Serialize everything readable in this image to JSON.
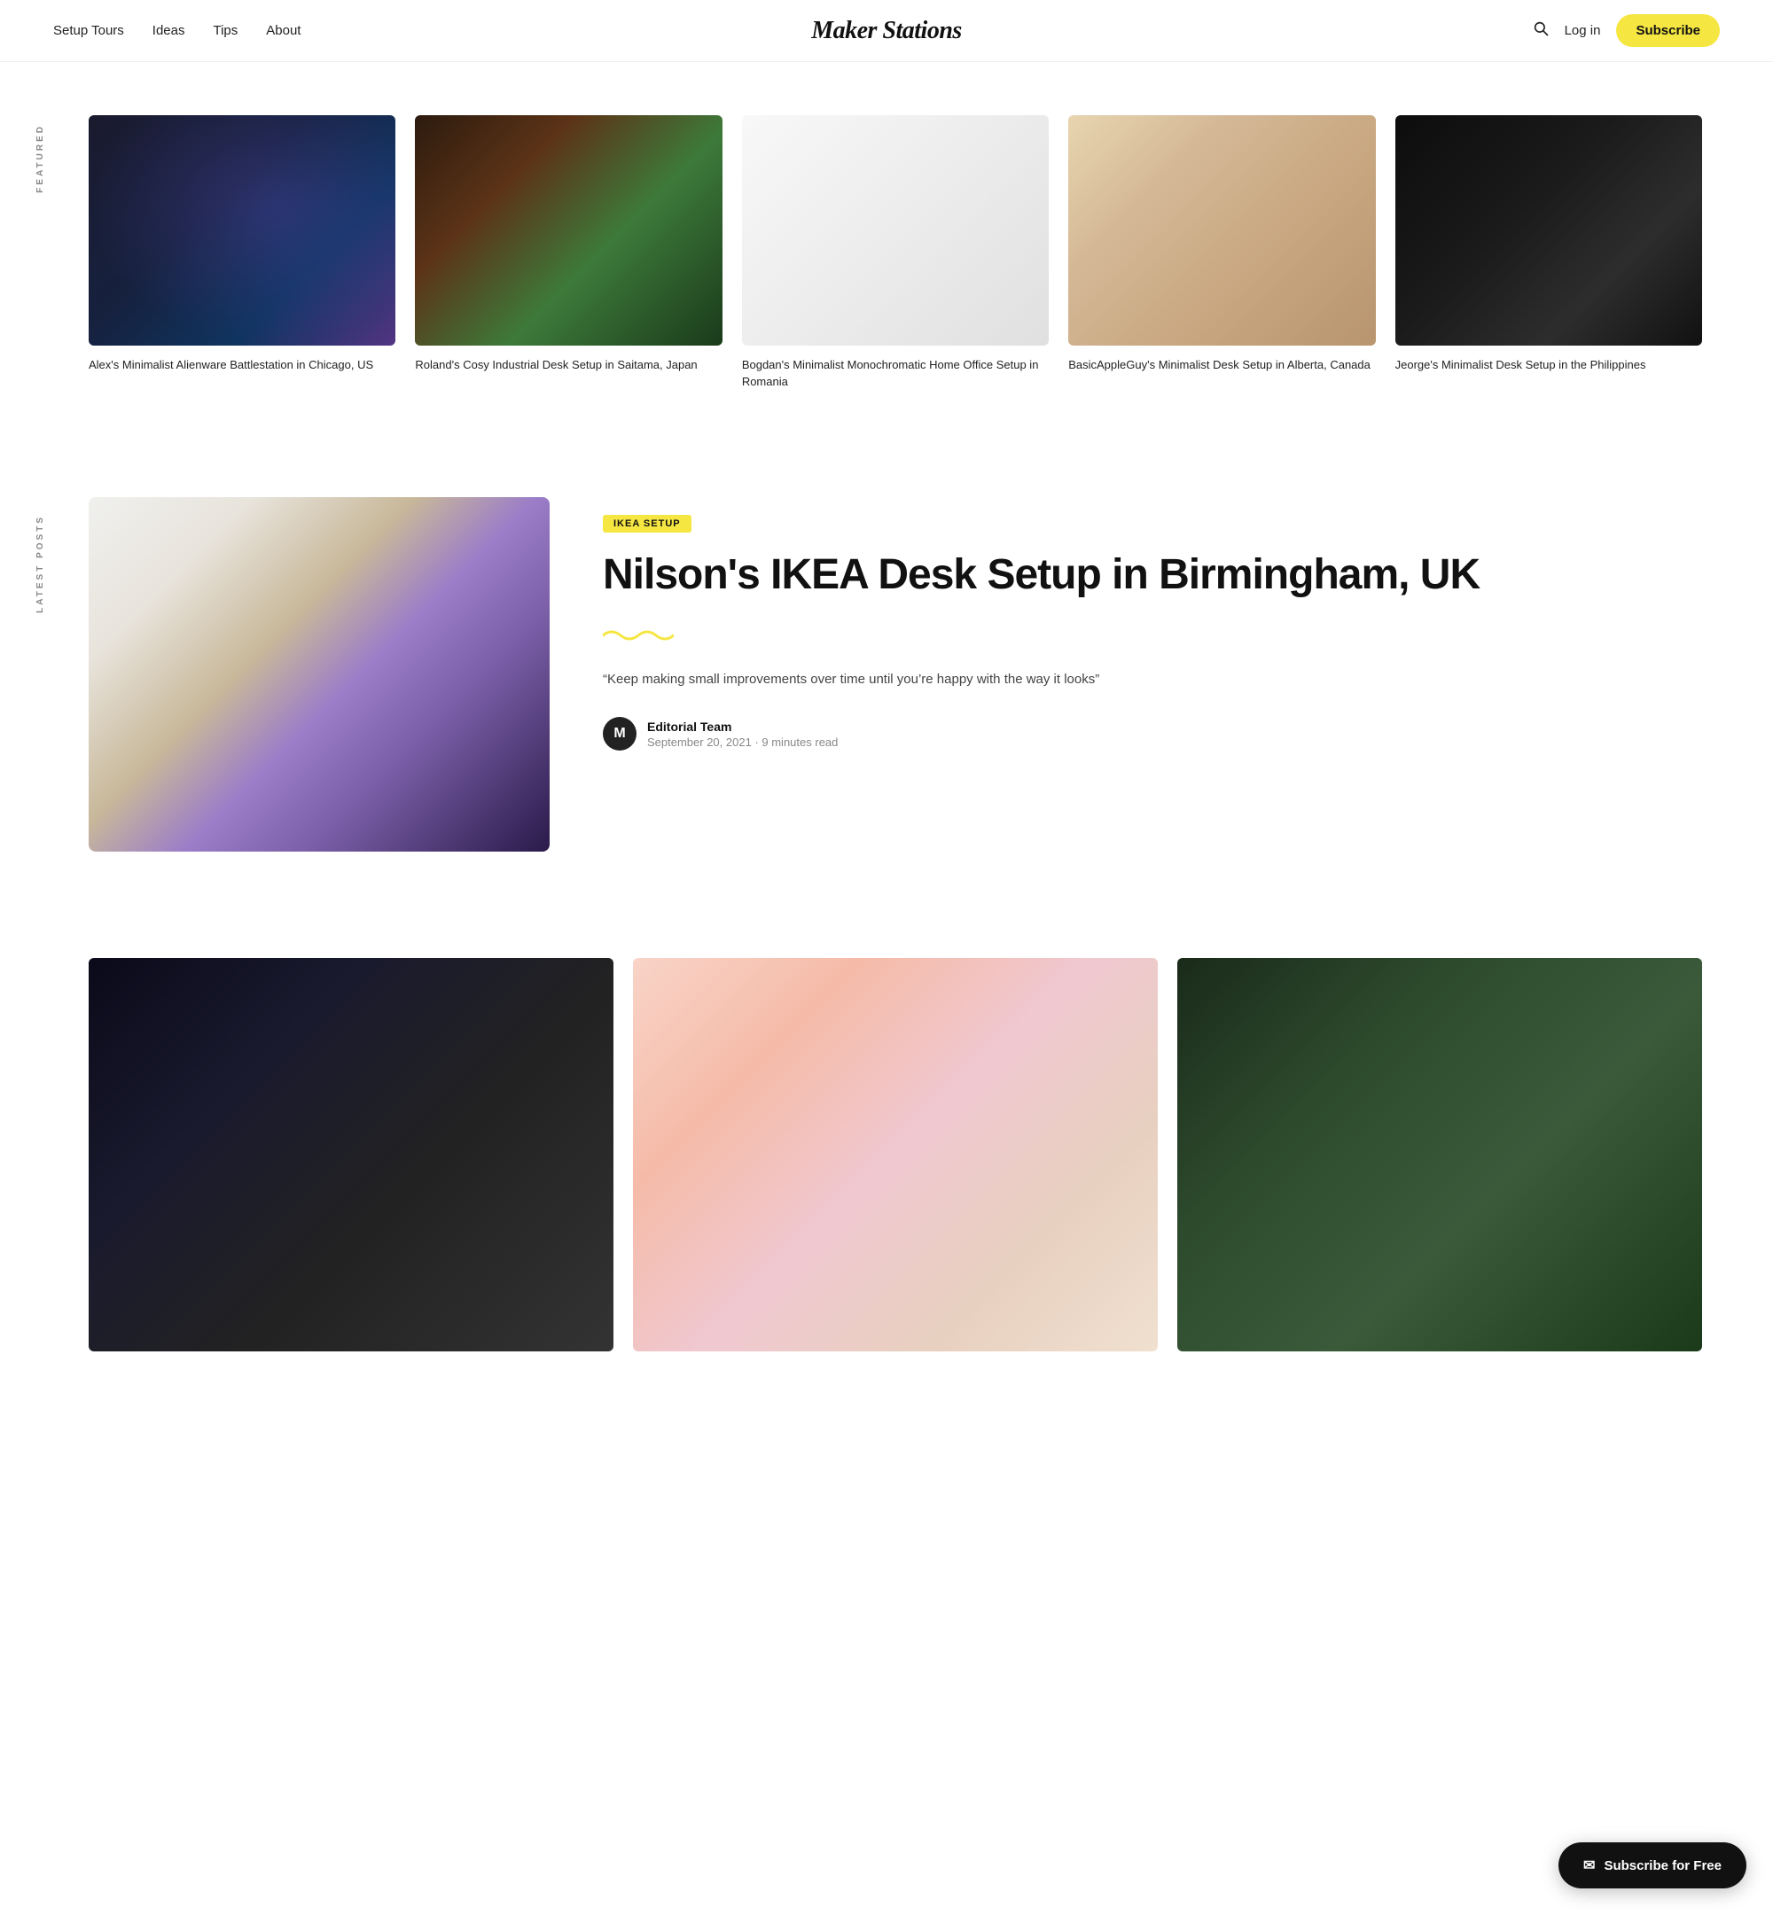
{
  "nav": {
    "links": [
      {
        "label": "Setup Tours",
        "key": "setup-tours"
      },
      {
        "label": "Ideas",
        "key": "ideas"
      },
      {
        "label": "Tips",
        "key": "tips"
      },
      {
        "label": "About",
        "key": "about"
      }
    ],
    "logo": "Maker Stations",
    "login_label": "Log in",
    "subscribe_label": "Subscribe"
  },
  "featured": {
    "section_label": "FEATURED",
    "items": [
      {
        "title": "Alex's Minimalist Alienware Battlestation in Chicago, US",
        "img_class": "img-alex"
      },
      {
        "title": "Roland's Cosy Industrial Desk Setup in Saitama, Japan",
        "img_class": "img-roland"
      },
      {
        "title": "Bogdan's Minimalist Monochromatic Home Office Setup in Romania",
        "img_class": "img-bogdan"
      },
      {
        "title": "BasicAppleGuy's Minimalist Desk Setup in Alberta, Canada",
        "img_class": "img-basicapple"
      },
      {
        "title": "Jeorge's Minimalist Desk Setup in the Philippines",
        "img_class": "img-jeorge"
      }
    ]
  },
  "latest": {
    "section_label": "LATEST POSTS",
    "post": {
      "tag": "IKEA SETUP",
      "title": "Nilson's IKEA Desk Setup in Birmingham, UK",
      "wavy": "~~~",
      "quote": "“Keep making small improvements over time until you’re happy with the way it looks”",
      "author_initial": "M",
      "author_name": "Editorial Team",
      "date": "September 20, 2021",
      "read_time": "9 minutes read",
      "img_class": "img-nilson"
    }
  },
  "bottom_grid": {
    "items": [
      {
        "img_class": "img-bottom1"
      },
      {
        "img_class": "img-bottom2"
      },
      {
        "img_class": "img-bottom3"
      }
    ]
  },
  "subscribe_float": {
    "label": "Subscribe for Free"
  }
}
